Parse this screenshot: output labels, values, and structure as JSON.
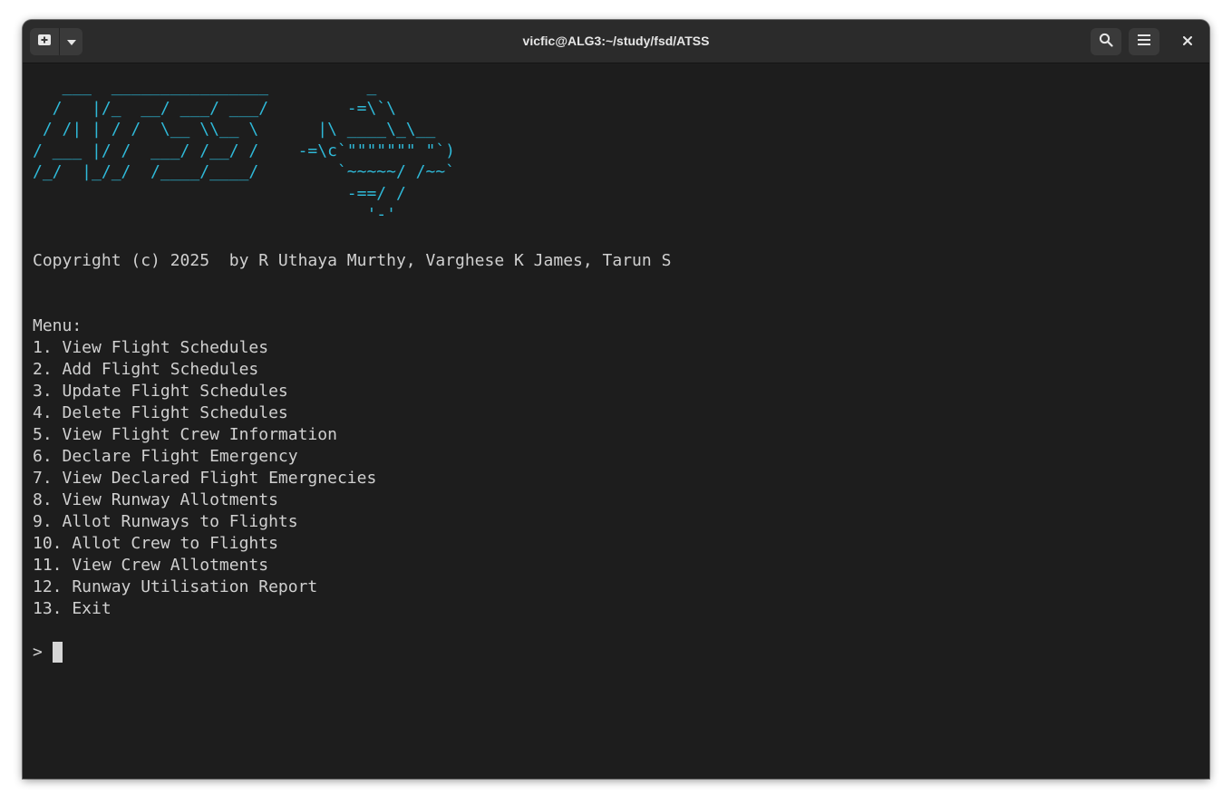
{
  "window": {
    "title": "vicfic@ALG3:~/study/fsd/ATSS"
  },
  "titlebar": {
    "new_tab_icon": "new-tab-icon",
    "dropdown_icon": "chevron-down-icon",
    "search_icon": "search-icon",
    "menu_icon": "hamburger-menu-icon",
    "close_icon": "close-icon"
  },
  "terminal": {
    "banner": "   ___  ________________          _\n  /   |/_  __/ ___/ ___/        -=\\`\\\n / /| | / /  \\__ \\\\__ \\      |\\ ____\\_\\__\n/ ___ |/ /  ___/ /__/ /    -=\\c`\"\"\"\"\"\"\" \"`)\n/_/  |_/_/  /____/____/        `~~~~~/ /~~`\n                                -==/ /\n                                  '-'",
    "banner_color": "#2fb9d8",
    "text_color": "#d0d0d0",
    "background": "#1d1d1d",
    "copyright": "Copyright (c) 2025  by R Uthaya Murthy, Varghese K James, Tarun S",
    "menu_header": "Menu:",
    "menu_items": [
      "1. View Flight Schedules",
      "2. Add Flight Schedules",
      "3. Update Flight Schedules",
      "4. Delete Flight Schedules",
      "5. View Flight Crew Information",
      "6. Declare Flight Emergency",
      "7. View Declared Flight Emergnecies",
      "8. View Runway Allotments",
      "9. Allot Runways to Flights",
      "10. Allot Crew to Flights",
      "11. View Crew Allotments",
      "12. Runway Utilisation Report",
      "13. Exit"
    ],
    "prompt": ">"
  }
}
